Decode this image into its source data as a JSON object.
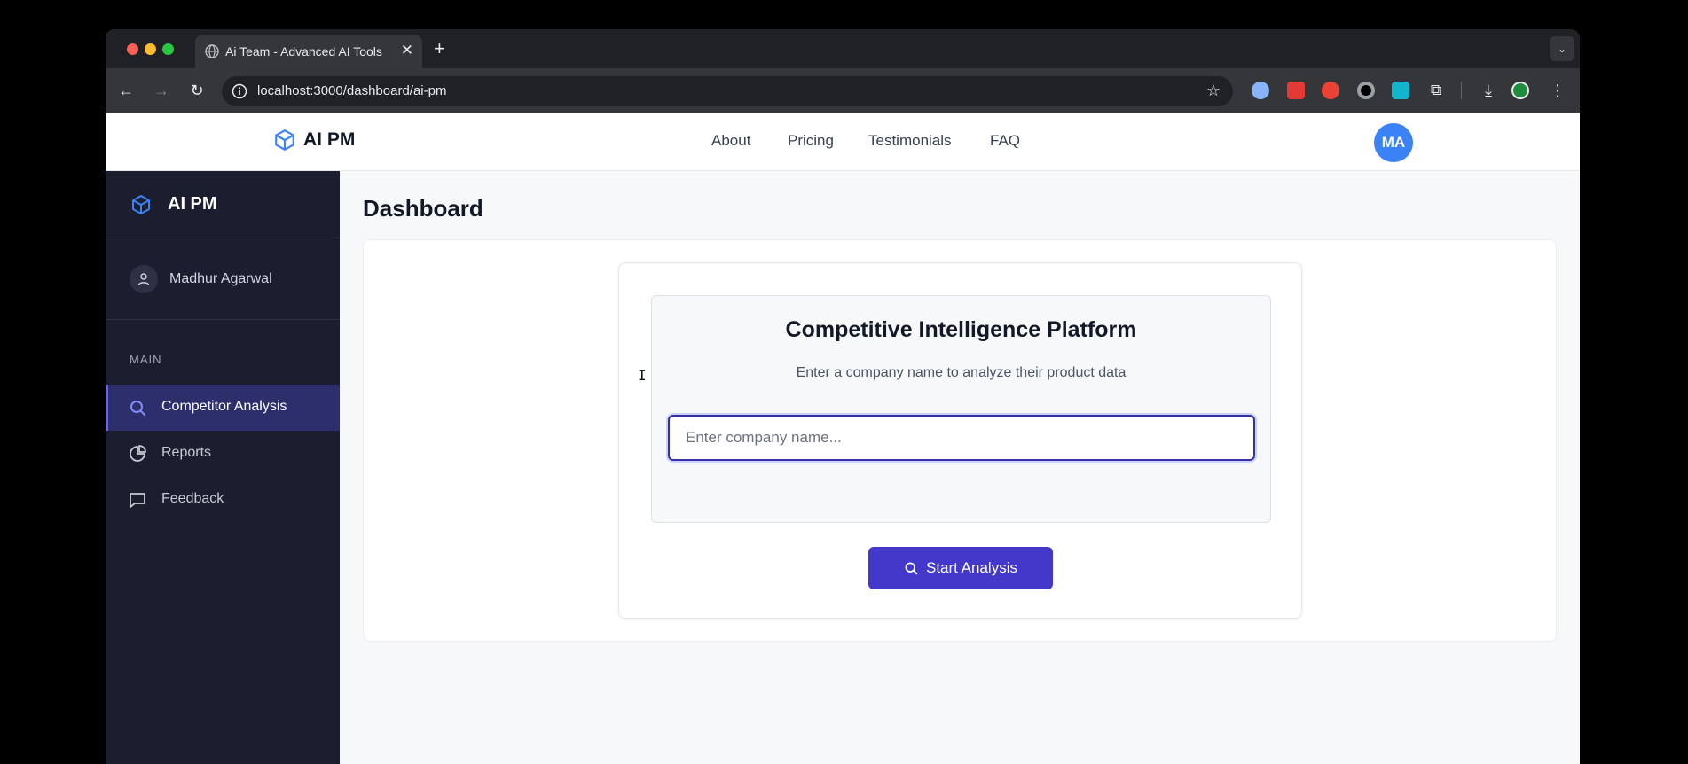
{
  "browser": {
    "tab_title": "Ai Team - Advanced AI Tools",
    "new_tab": "+",
    "url": "localhost:3000/dashboard/ai-pm"
  },
  "topnav": {
    "brand": "AI PM",
    "links": [
      "About",
      "Pricing",
      "Testimonials",
      "FAQ"
    ],
    "avatar_initials": "MA"
  },
  "sidebar": {
    "brand": "AI PM",
    "user_name": "Madhur Agarwal",
    "section_label": "MAIN",
    "items": [
      {
        "label": "Competitor Analysis",
        "icon": "search-icon",
        "active": true
      },
      {
        "label": "Reports",
        "icon": "pie-chart-icon",
        "active": false
      },
      {
        "label": "Feedback",
        "icon": "message-square-icon",
        "active": false
      }
    ]
  },
  "main": {
    "title": "Dashboard",
    "card_title": "Competitive Intelligence Platform",
    "card_subtitle": "Enter a company name to analyze their product data",
    "input_placeholder": "Enter company name...",
    "input_value": "",
    "button_label": "Start Analysis"
  },
  "colors": {
    "accent": "#4338ca",
    "sidebar_bg": "#1c1d2e",
    "avatar": "#3b82f6",
    "brand_icon": "#3b82f6"
  }
}
